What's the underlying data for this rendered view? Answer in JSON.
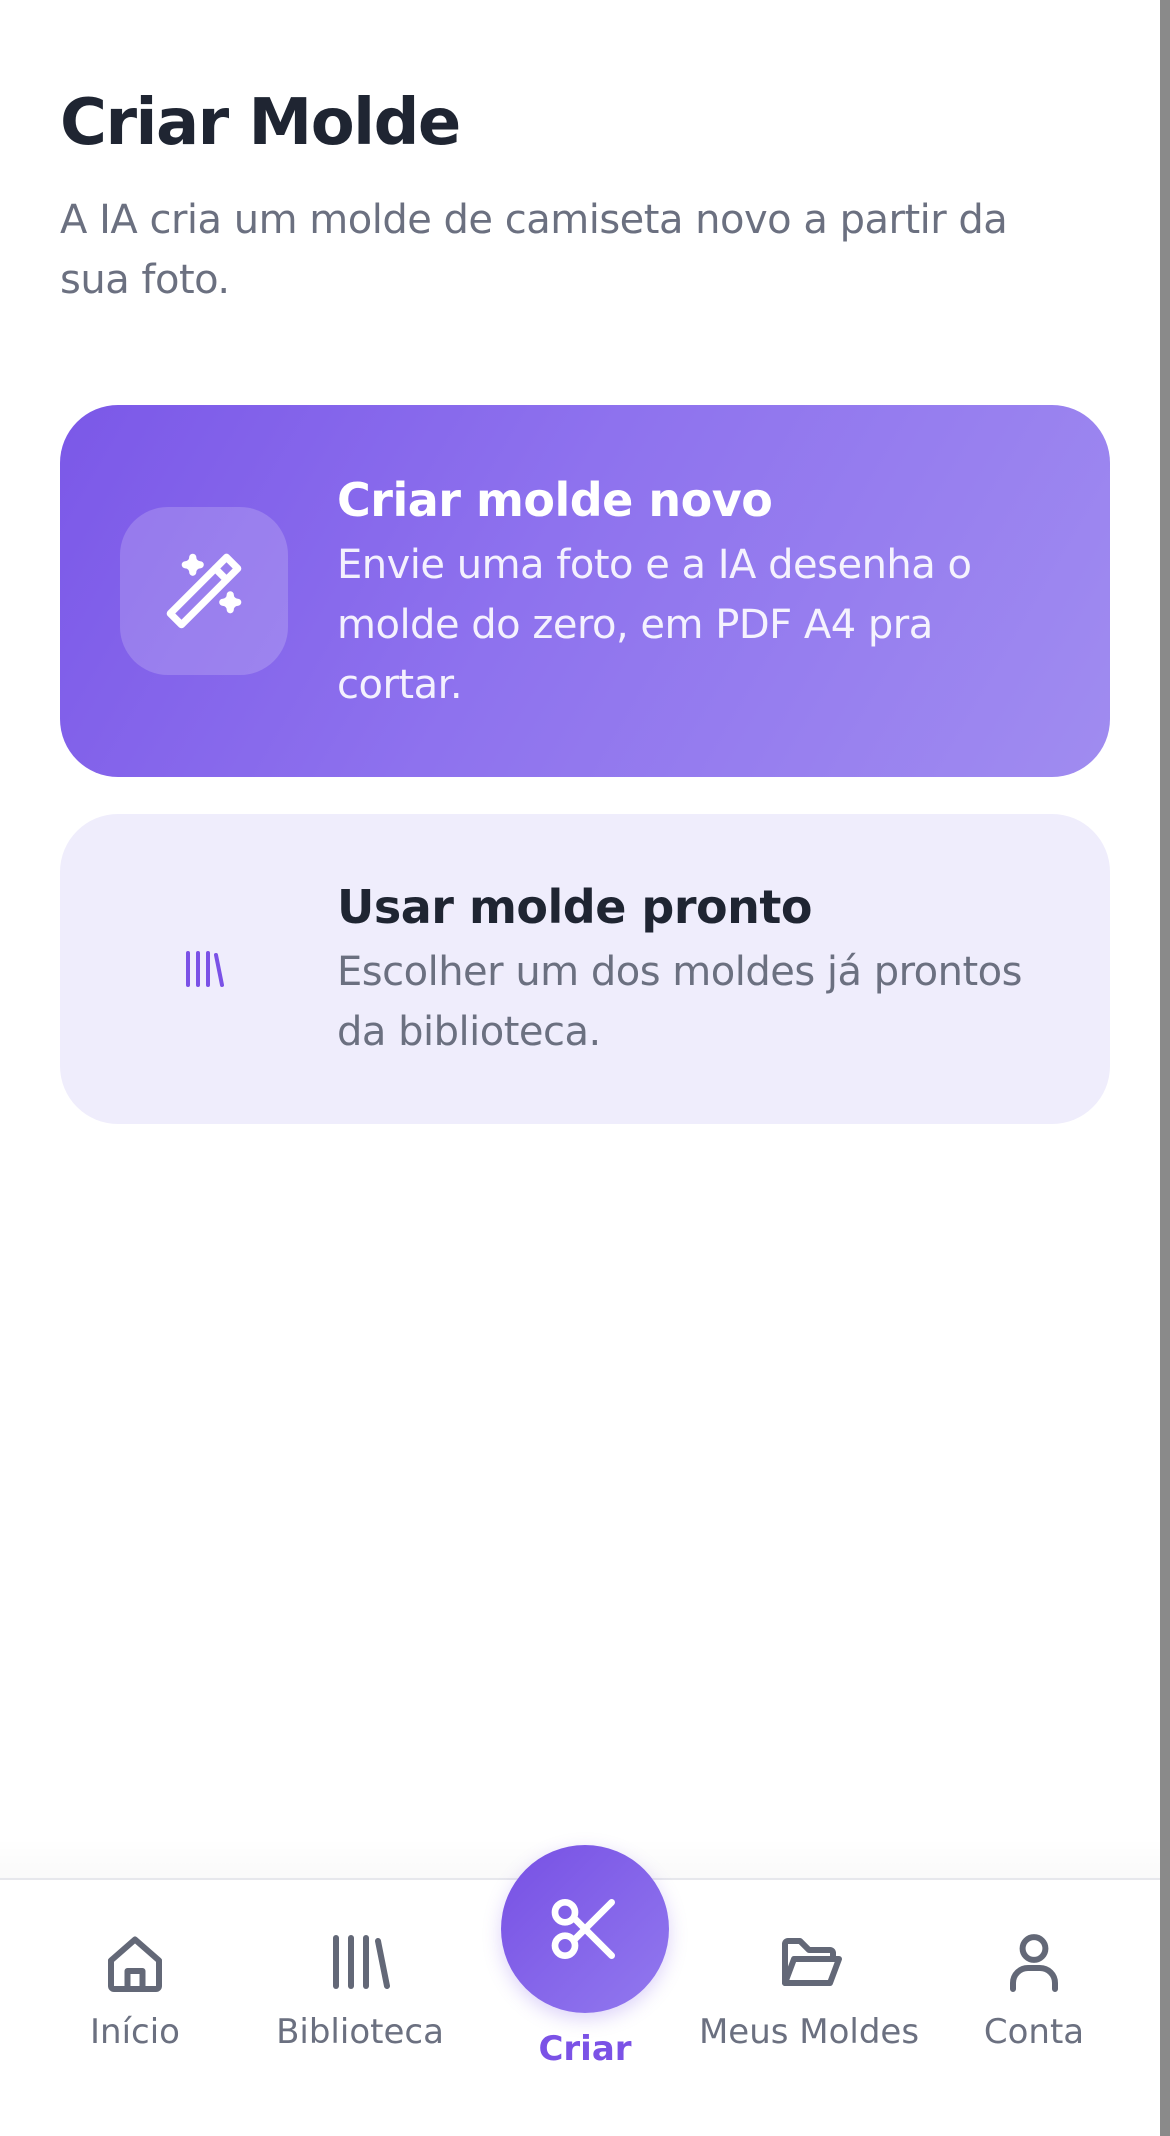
{
  "header": {
    "title": "Criar Molde",
    "subtitle": "A IA cria um molde de camiseta novo a partir da sua foto."
  },
  "cards": [
    {
      "title": "Criar molde novo",
      "description": "Envie uma foto e a IA desenha o molde do zero, em PDF A4 pra cortar.",
      "icon": "magic-wand-icon"
    },
    {
      "title": "Usar molde pronto",
      "description": "Escolher um dos moldes já prontos da biblioteca.",
      "icon": "library-icon"
    }
  ],
  "bottom_nav": {
    "items": [
      {
        "label": "Início",
        "icon": "home-icon"
      },
      {
        "label": "Biblioteca",
        "icon": "library-icon"
      },
      {
        "label": "Criar",
        "icon": "scissors-icon",
        "active": true
      },
      {
        "label": "Meus Moldes",
        "icon": "folder-open-icon"
      },
      {
        "label": "Conta",
        "icon": "user-icon"
      }
    ]
  },
  "colors": {
    "accent": "#7b52e6",
    "primary_card_gradient_start": "#7b58e8",
    "primary_card_gradient_end": "#a08cf0",
    "secondary_card_bg": "#efedfc",
    "title_text": "#1f2532",
    "muted_text": "#6b7080"
  }
}
